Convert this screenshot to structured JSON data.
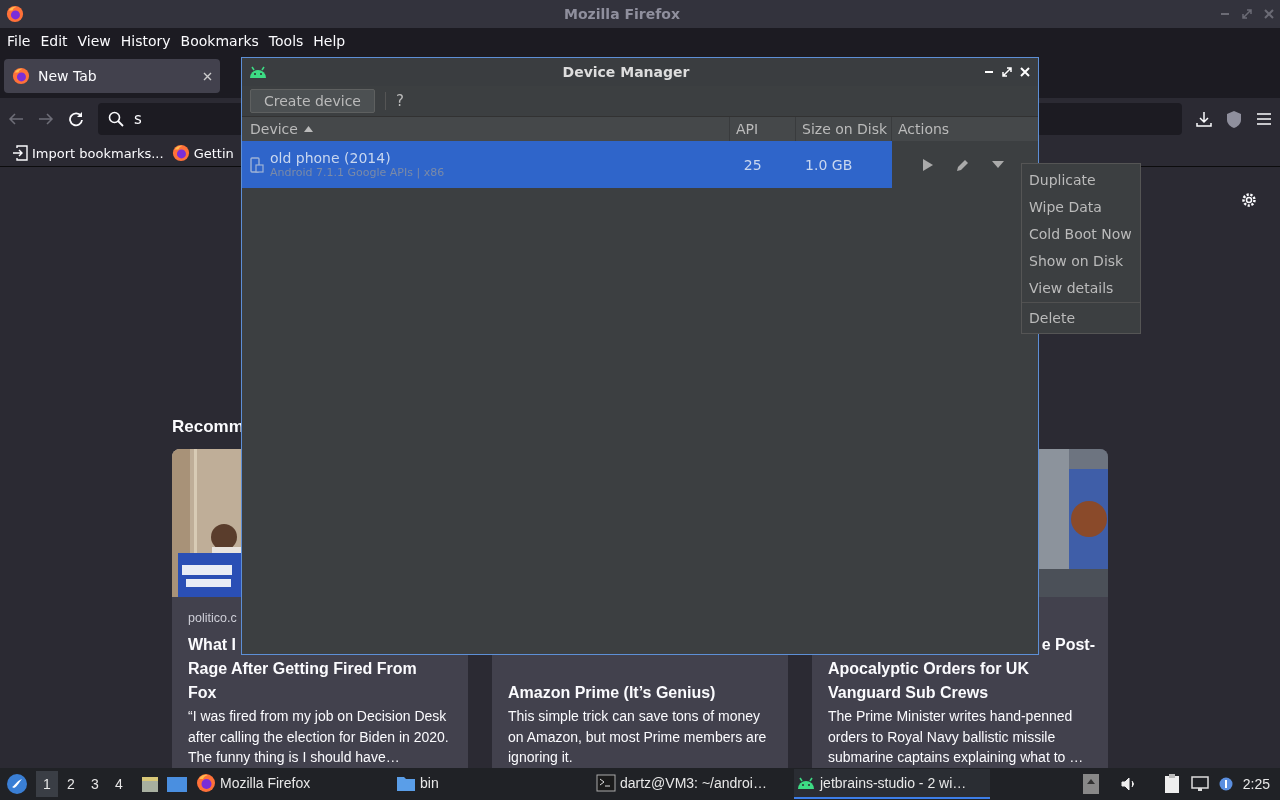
{
  "firefox": {
    "window_title": "Mozilla Firefox",
    "menu": [
      "File",
      "Edit",
      "View",
      "History",
      "Bookmarks",
      "Tools",
      "Help"
    ],
    "tabs": [
      {
        "label": "New Tab",
        "selected": true
      }
    ],
    "url_field": {
      "value": "s"
    },
    "bookmarks": [
      {
        "label": "Import bookmarks...",
        "kind": "import"
      },
      {
        "label": "Gettin",
        "kind": "firefox"
      }
    ],
    "recommended": {
      "heading": "Recomm",
      "cards": [
        {
          "source": "politico.c",
          "title_lines": [
            "What I",
            "Rage After Getting Fired From",
            "Fox"
          ],
          "description": "“I was fired from my job on Decision Desk after calling the election for Biden in 2020. The funny thing is I should have…"
        },
        {
          "title_lines": [
            "Amazon Prime (It’s Genius)"
          ],
          "description": "This simple trick can save tons of money on Amazon, but most Prime members are ignoring it."
        },
        {
          "title_lines": [
            "e Post-",
            "Apocalyptic Orders for UK",
            "Vanguard Sub Crews"
          ],
          "description": "The Prime Minister writes hand-penned orders to Royal Navy ballistic missile submarine captains explaining what to …"
        }
      ]
    }
  },
  "device_manager": {
    "title": "Device Manager",
    "create_button": "Create device",
    "help_button": "?",
    "columns": [
      {
        "label": "Device",
        "sorted": true
      },
      {
        "label": "API",
        "sorted": false
      },
      {
        "label": "Size on Disk",
        "sorted": false
      },
      {
        "label": "Actions",
        "sorted": false
      }
    ],
    "rows": [
      {
        "name": "old phone (2014)",
        "details": "Android 7.1.1 Google APIs | x86",
        "api": "25",
        "size": "1.0 GB",
        "selected": true
      }
    ]
  },
  "context_menu": {
    "groups": [
      [
        "Duplicate",
        "Wipe Data",
        "Cold Boot Now",
        "Show on Disk",
        "View details"
      ],
      [
        "Delete"
      ]
    ]
  },
  "taskbar": {
    "workspaces": [
      {
        "label": "1",
        "selected": true
      },
      {
        "label": "2",
        "selected": false
      },
      {
        "label": "3",
        "selected": false
      },
      {
        "label": "4",
        "selected": false
      }
    ],
    "tasks": [
      {
        "label": "Mozilla Firefox",
        "kind": "firefox",
        "selected": false
      },
      {
        "label": "bin",
        "kind": "folder",
        "selected": false
      },
      {
        "label": "dartz@VM3: ~/androi…",
        "kind": "terminal",
        "selected": false
      },
      {
        "label": "jetbrains-studio - 2 wi…",
        "kind": "android",
        "selected": true
      }
    ],
    "clock": "2:25"
  }
}
